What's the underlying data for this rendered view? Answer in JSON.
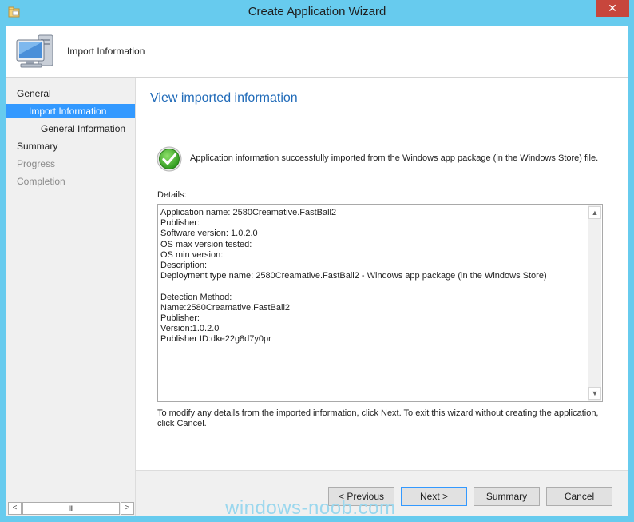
{
  "window": {
    "title": "Create Application Wizard",
    "close_glyph": "✕"
  },
  "header": {
    "title": "Import Information",
    "icon": "monitor-computer-icon"
  },
  "sidebar": {
    "items": [
      {
        "label": "General",
        "state": "normal"
      },
      {
        "label": "Import Information",
        "state": "selected"
      },
      {
        "label": "General Information",
        "state": "normal"
      },
      {
        "label": "Summary",
        "state": "normal"
      },
      {
        "label": "Progress",
        "state": "disabled"
      },
      {
        "label": "Completion",
        "state": "disabled"
      }
    ],
    "scroll_left": "<",
    "scroll_thumb": "III",
    "scroll_right": ">"
  },
  "main": {
    "heading": "View imported information",
    "success_icon": "green-check-icon",
    "success_text": "Application information successfully imported from the Windows app package (in the Windows Store) file.",
    "details_label": "Details:",
    "details_lines": [
      "Application name: 2580Creamative.FastBall2",
      "Publisher:",
      "Software version: 1.0.2.0",
      "OS max version tested:",
      "OS min version:",
      "Description:",
      "Deployment type name: 2580Creamative.FastBall2 - Windows app package (in the Windows Store)",
      "",
      "Detection Method:",
      "Name:2580Creamative.FastBall2",
      "Publisher:",
      "Version:1.0.2.0",
      "Publisher ID:dke22g8d7y0pr"
    ],
    "scroll_up": "▲",
    "scroll_down": "▼",
    "footer_note": "To modify any details from the imported information, click Next. To exit this wizard without creating the application, click Cancel."
  },
  "buttons": {
    "previous": "< Previous",
    "next": "Next >",
    "summary": "Summary",
    "cancel": "Cancel"
  },
  "watermark": "windows-noob.com",
  "colors": {
    "frame": "#67cbee",
    "selection": "#3399ff",
    "heading": "#1f6ab8",
    "close": "#c7463c"
  }
}
